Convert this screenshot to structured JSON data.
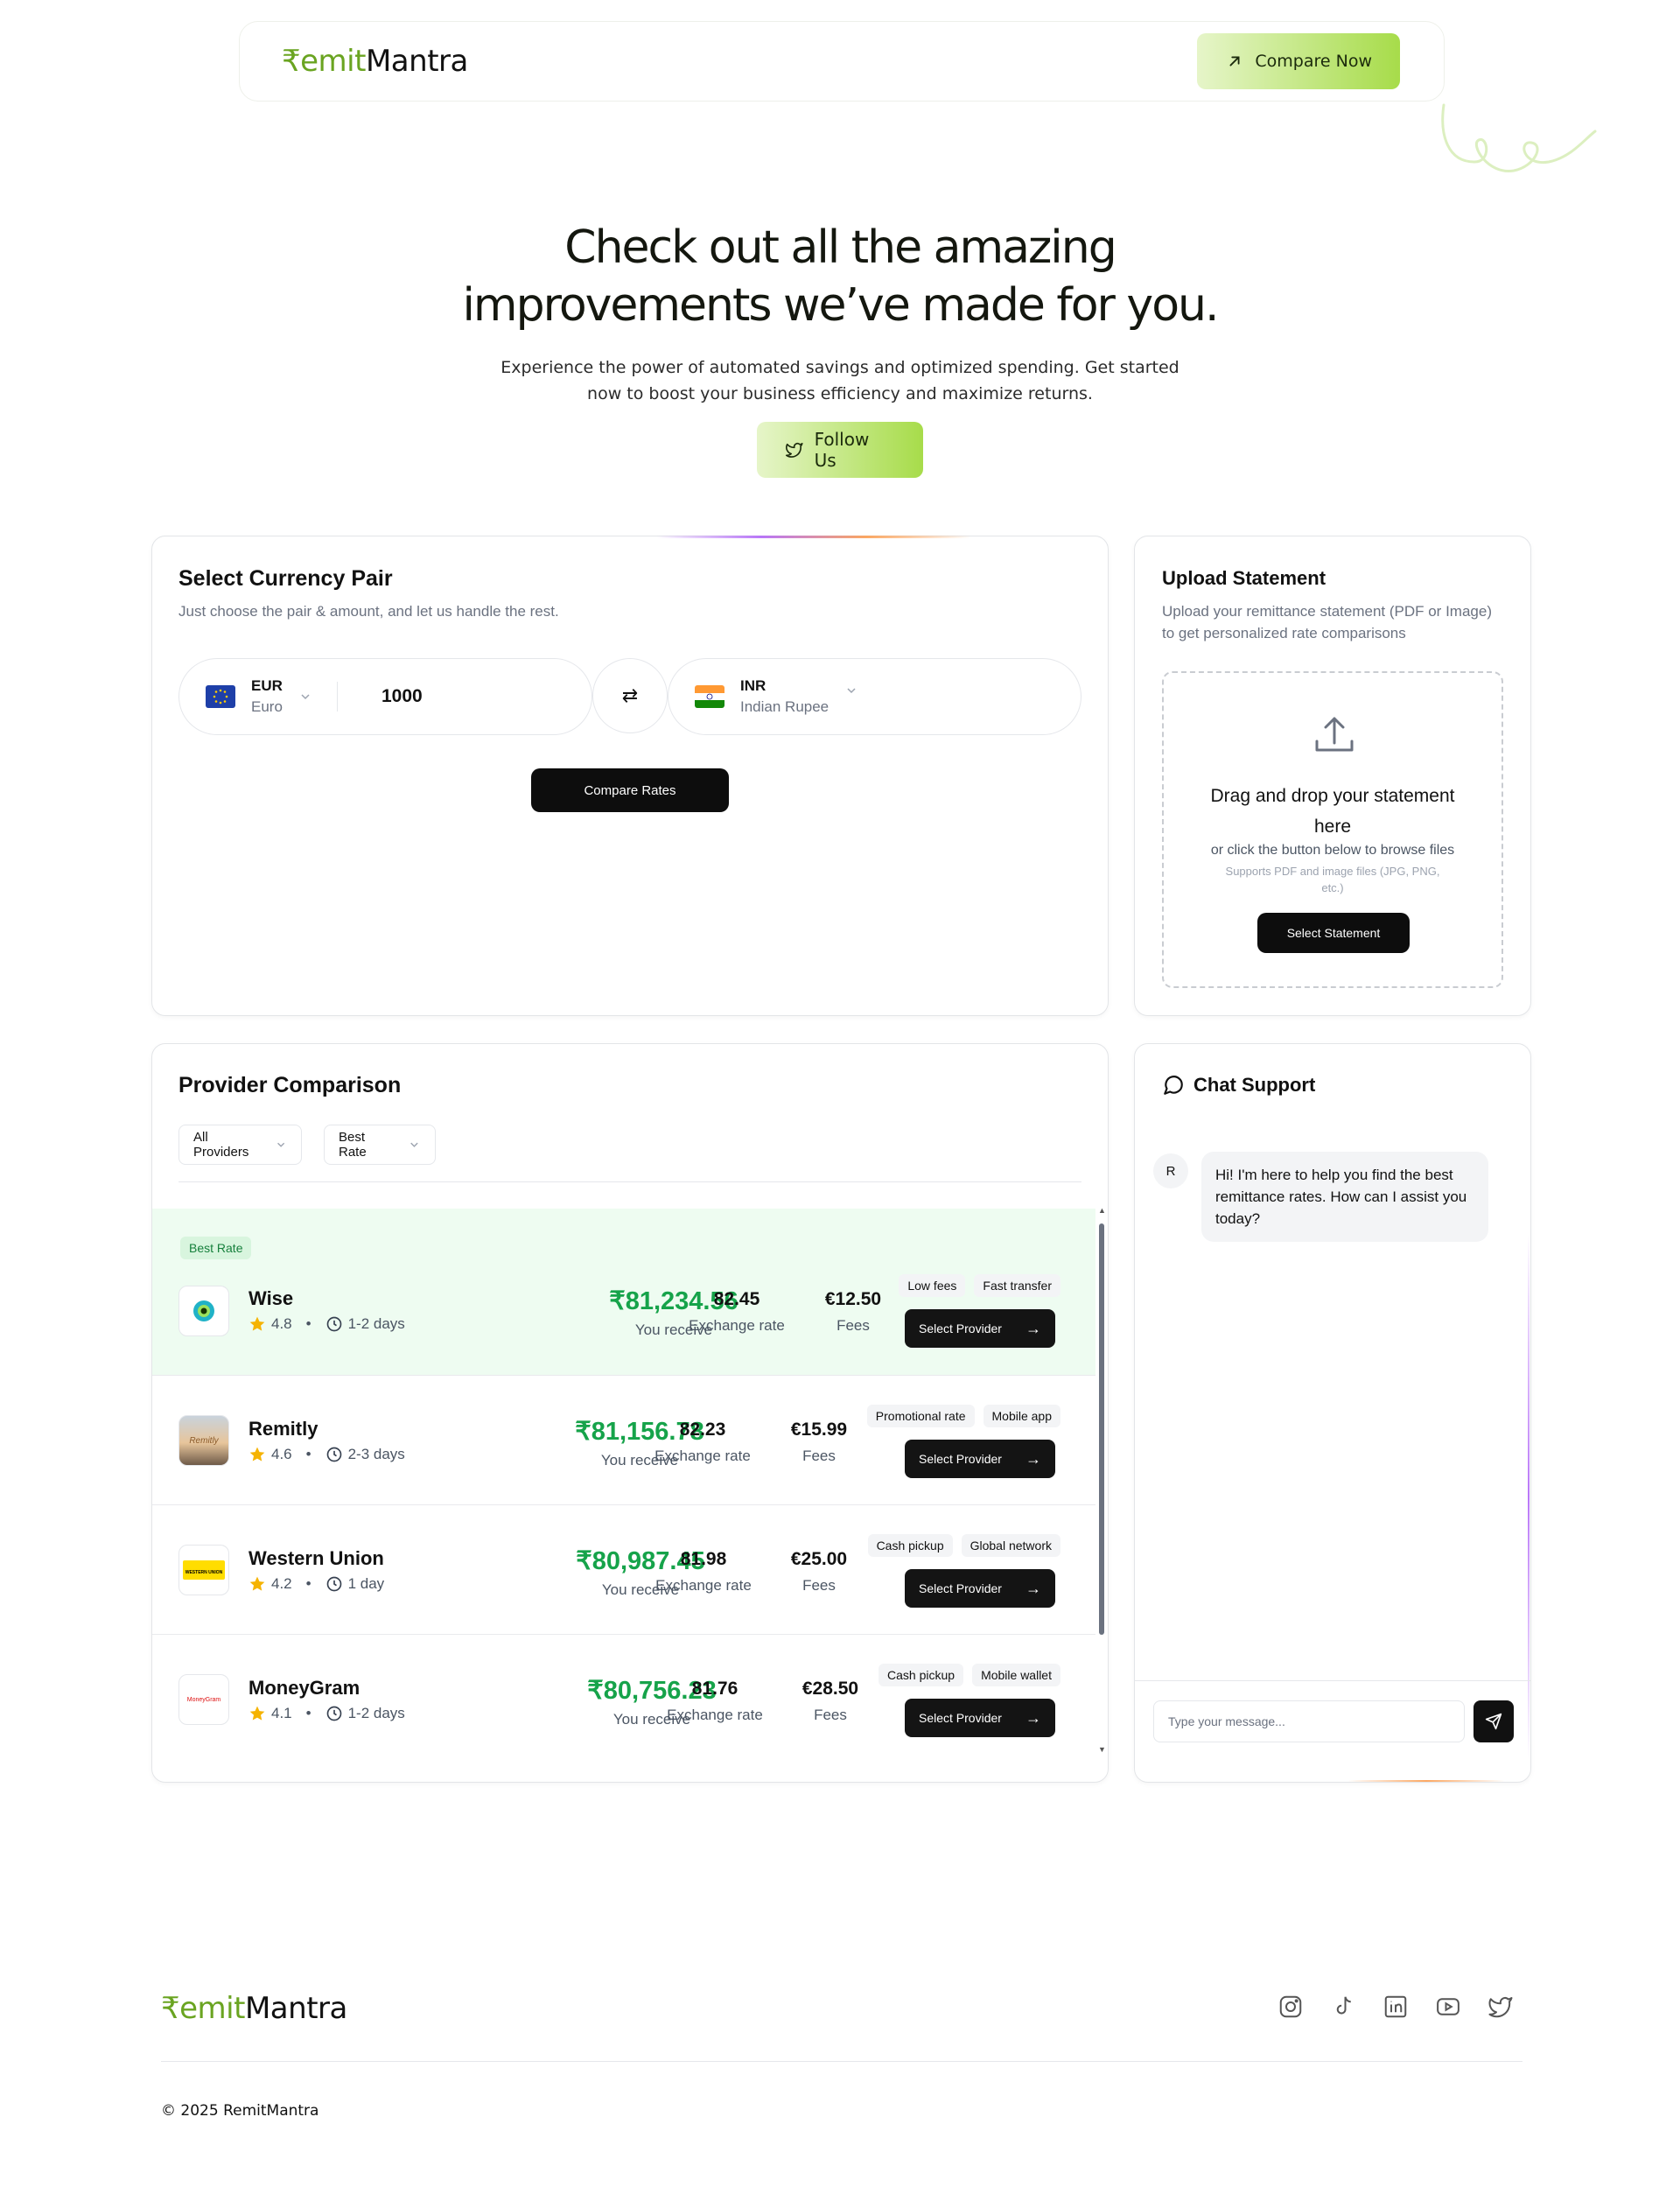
{
  "header": {
    "logo": {
      "rupee": "₹",
      "emit": "emit",
      "mantra": "Mantra"
    },
    "cta_label": "Compare Now"
  },
  "hero": {
    "title_line1": "Check out all the amazing",
    "title_line2": "improvements we’ve made for you.",
    "subtitle_line1": "Experience the power of automated savings and optimized spending. Get started",
    "subtitle_line2": "now to boost your business efficiency and maximize returns.",
    "follow_label": "Follow Us"
  },
  "currency": {
    "title": "Select Currency Pair",
    "subtitle": "Just choose the pair & amount, and let us handle the rest.",
    "from_code": "EUR",
    "from_name": "Euro",
    "amount": "1000",
    "to_code": "INR",
    "to_name": "Indian Rupee",
    "compare_label": "Compare Rates"
  },
  "upload": {
    "title": "Upload Statement",
    "subtitle_line1": "Upload your remittance statement (PDF or Image)",
    "subtitle_line2": "to get personalized rate comparisons",
    "drop_line1": "Drag and drop your statement",
    "drop_line2": "here",
    "browse_hint": "or click the button below to browse files",
    "supports_line1": "Supports PDF and image files (JPG, PNG,",
    "supports_line2": "etc.)",
    "button_label": "Select Statement"
  },
  "providers": {
    "title": "Provider Comparison",
    "filter_all": "All Providers",
    "filter_sort": "Best Rate",
    "best_badge": "Best Rate",
    "receive_label": "You receive",
    "rate_label": "Exchange rate",
    "fees_label": "Fees",
    "select_label": "Select Provider",
    "items": [
      {
        "name": "Wise",
        "rating": "4.8",
        "time": "1-2 days",
        "receive": "₹81,234.56",
        "rate": "82.45",
        "fees": "€12.50",
        "tags": [
          "Low fees",
          "Fast transfer"
        ],
        "logo_text": ""
      },
      {
        "name": "Remitly",
        "rating": "4.6",
        "time": "2-3 days",
        "receive": "₹81,156.78",
        "rate": "82.23",
        "fees": "€15.99",
        "tags": [
          "Promotional rate",
          "Mobile app"
        ],
        "logo_text": "Remitly"
      },
      {
        "name": "Western Union",
        "rating": "4.2",
        "time": "1 day",
        "receive": "₹80,987.45",
        "rate": "81.98",
        "fees": "€25.00",
        "tags": [
          "Cash pickup",
          "Global network"
        ],
        "logo_text": "WESTERN UNION"
      },
      {
        "name": "MoneyGram",
        "rating": "4.1",
        "time": "1-2 days",
        "receive": "₹80,756.23",
        "rate": "81.76",
        "fees": "€28.50",
        "tags": [
          "Cash pickup",
          "Mobile wallet"
        ],
        "logo_text": "MoneyGram"
      }
    ]
  },
  "chat": {
    "title": "Chat Support",
    "avatar": "R",
    "message": "Hi! I'm here to help you find the best remittance rates. How can I assist you today?",
    "placeholder": "Type your message..."
  },
  "footer": {
    "copyright": "© 2025 RemitMantra",
    "socials": [
      "instagram-icon",
      "tiktok-icon",
      "linkedin-icon",
      "youtube-icon",
      "twitter-icon"
    ]
  },
  "colors": {
    "brand_green": "#6aa421",
    "receive_green": "#16a34a",
    "best_row_bg": "#eefcf1"
  }
}
